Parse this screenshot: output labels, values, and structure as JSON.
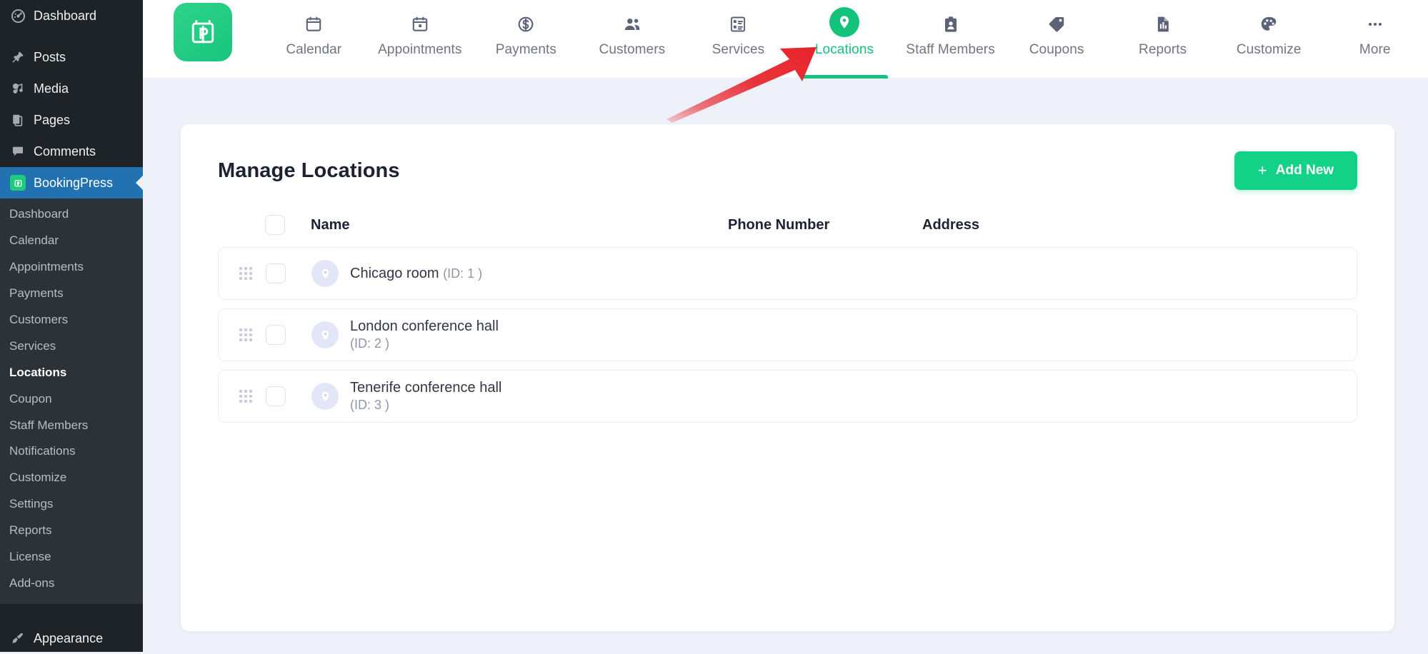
{
  "wp_sidebar": {
    "top_items": [
      {
        "label": "Dashboard",
        "icon": "dashboard-icon"
      },
      {
        "label": "Posts",
        "icon": "pin-icon"
      },
      {
        "label": "Media",
        "icon": "media-icon"
      },
      {
        "label": "Pages",
        "icon": "pages-icon"
      },
      {
        "label": "Comments",
        "icon": "comments-icon"
      }
    ],
    "active_item": {
      "label": "BookingPress",
      "icon": "bookingpress-icon"
    },
    "submenu": [
      "Dashboard",
      "Calendar",
      "Appointments",
      "Payments",
      "Customers",
      "Services",
      "Locations",
      "Coupon",
      "Staff Members",
      "Notifications",
      "Customize",
      "Settings",
      "Reports",
      "License",
      "Add-ons"
    ],
    "submenu_current": "Locations",
    "bottom_item": {
      "label": "Appearance",
      "icon": "paintbrush-icon"
    }
  },
  "topnav": {
    "brand_icon": "bookingpress-logo-icon",
    "tabs": [
      {
        "label": "Calendar",
        "icon": "calendar-icon",
        "active": false
      },
      {
        "label": "Appointments",
        "icon": "appointments-icon",
        "active": false
      },
      {
        "label": "Payments",
        "icon": "dollar-icon",
        "active": false
      },
      {
        "label": "Customers",
        "icon": "customers-icon",
        "active": false
      },
      {
        "label": "Services",
        "icon": "services-icon",
        "active": false
      },
      {
        "label": "Locations",
        "icon": "location-pin-icon",
        "active": true
      },
      {
        "label": "Staff Members",
        "icon": "id-badge-icon",
        "active": false
      },
      {
        "label": "Coupons",
        "icon": "tag-icon",
        "active": false
      },
      {
        "label": "Reports",
        "icon": "report-icon",
        "active": false
      },
      {
        "label": "Customize",
        "icon": "palette-icon",
        "active": false
      },
      {
        "label": "More",
        "icon": "ellipsis-icon",
        "active": false
      }
    ]
  },
  "page": {
    "title": "Manage Locations",
    "add_new_label": "Add New",
    "add_new_plus": "+"
  },
  "table": {
    "columns": [
      "Name",
      "Phone Number",
      "Address"
    ],
    "rows": [
      {
        "name": "Chicago room",
        "id_text": "(ID: 1 )",
        "inline_id": true,
        "phone": "",
        "address": ""
      },
      {
        "name": "London conference hall",
        "id_text": "(ID: 2 )",
        "inline_id": false,
        "phone": "",
        "address": ""
      },
      {
        "name": "Tenerife conference hall",
        "id_text": "(ID: 3 )",
        "inline_id": false,
        "phone": "",
        "address": ""
      }
    ]
  },
  "annotation": {
    "type": "red-arrow",
    "color": "#e8232a",
    "points_to": "Locations"
  },
  "colors": {
    "accent_green": "#14c27b",
    "button_green": "#14d188",
    "wp_dark": "#1d2327",
    "wp_submenu": "#2c3338",
    "wp_active_blue": "#2271b1",
    "page_bg": "#eef1f9",
    "annotation_red": "#e8232a"
  }
}
